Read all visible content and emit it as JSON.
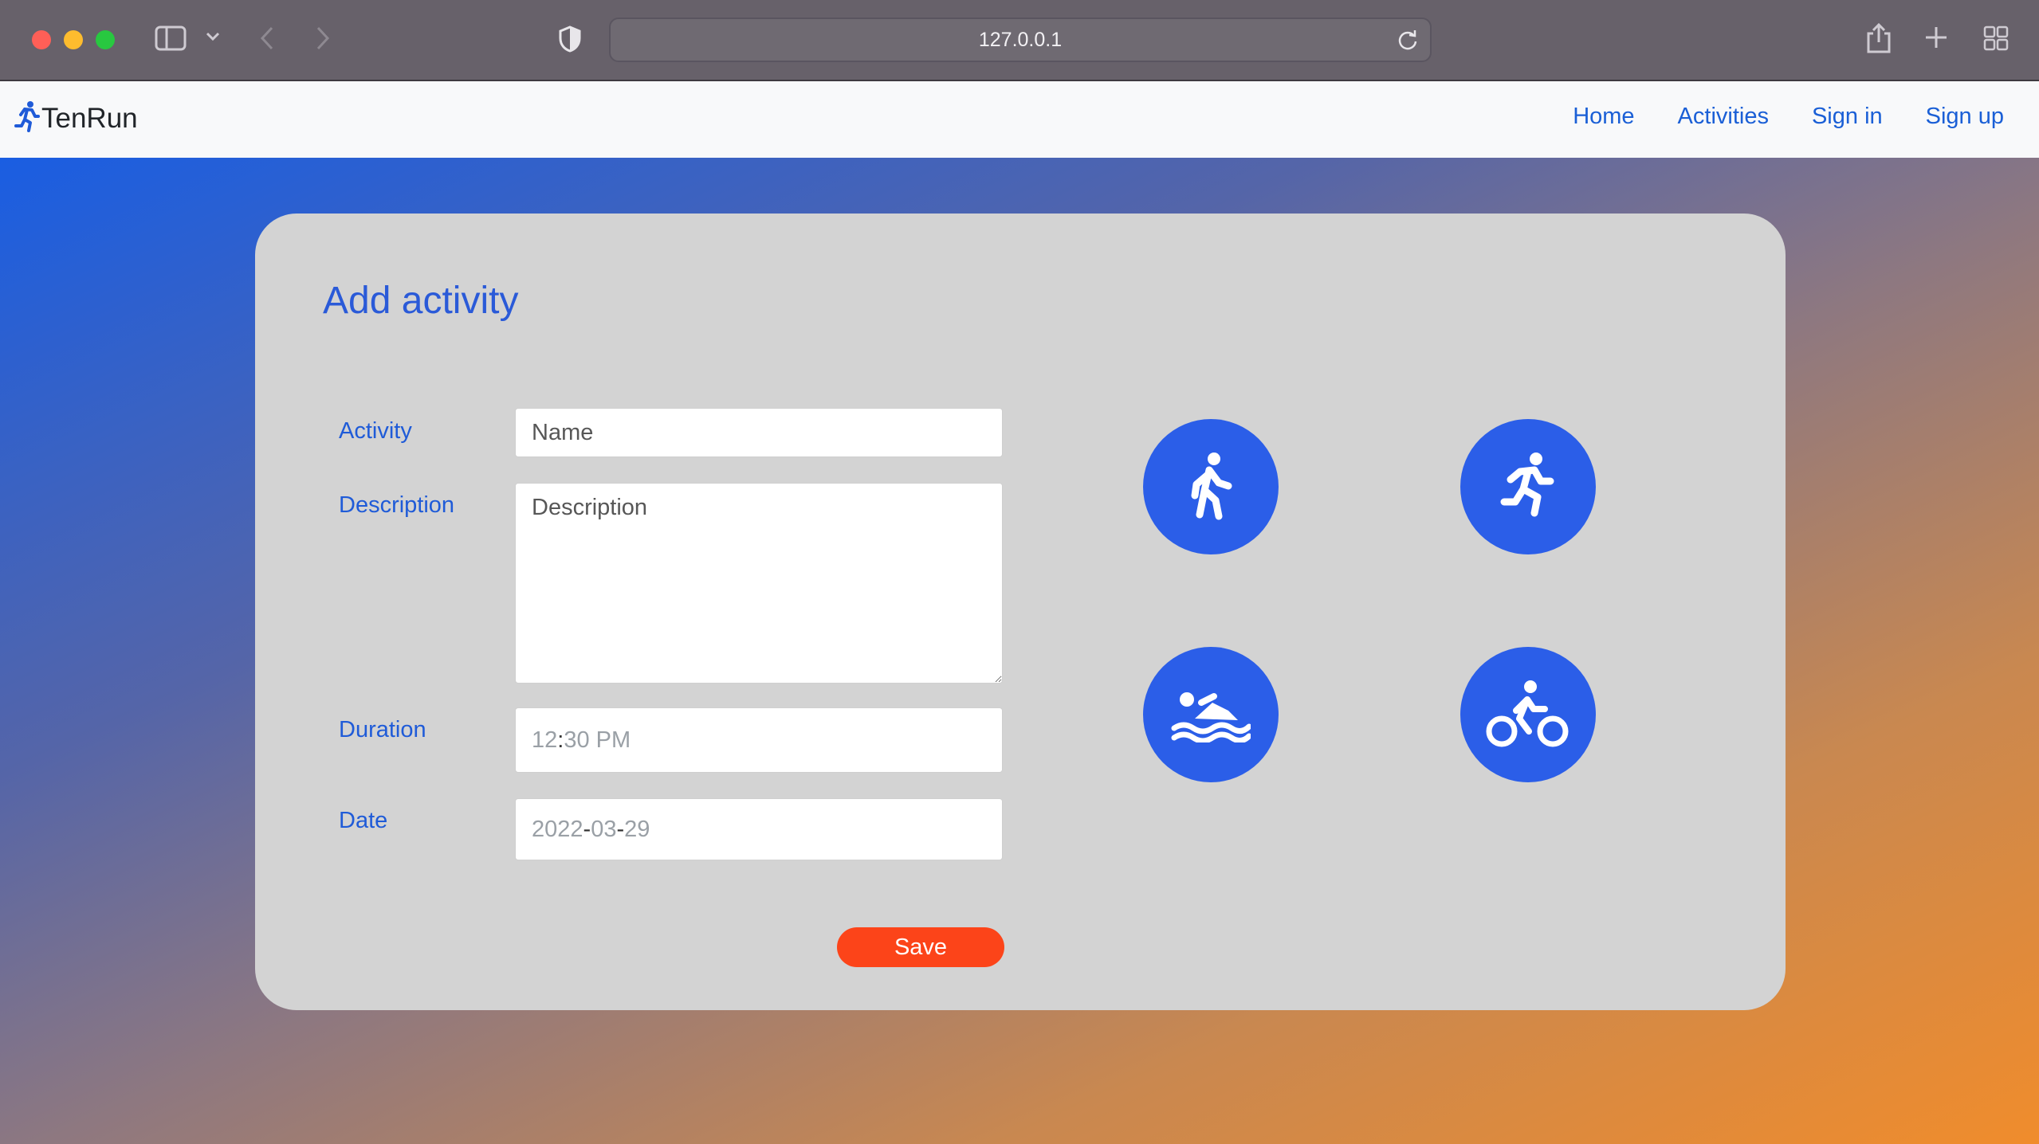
{
  "browser": {
    "url": "127.0.0.1",
    "icons": [
      "sidebar-icon",
      "chevron-down-icon",
      "back-icon",
      "forward-icon",
      "shield-icon",
      "reload-icon",
      "share-icon",
      "new-tab-icon",
      "tab-overview-icon"
    ]
  },
  "nav": {
    "brand": "TenRun",
    "links": [
      "Home",
      "Activities",
      "Sign in",
      "Sign up"
    ]
  },
  "form": {
    "title": "Add activity",
    "activity_label": "Activity",
    "activity_placeholder": "Name",
    "description_label": "Description",
    "description_placeholder": "Description",
    "duration_label": "Duration",
    "duration_hour": "12",
    "duration_minute": "30",
    "duration_period": "PM",
    "date_label": "Date",
    "date_year": "2022",
    "date_month": "03",
    "date_day": "29",
    "save_label": "Save"
  },
  "sports": [
    "walk-icon",
    "run-icon",
    "swim-icon",
    "bike-icon"
  ],
  "colors": {
    "accent": "#2b5ee8",
    "save": "#fc4419",
    "link": "#1a5fd6",
    "card": "#d3d3d3"
  }
}
